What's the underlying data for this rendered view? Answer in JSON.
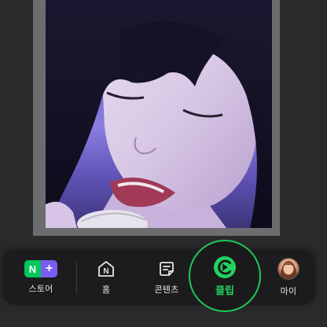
{
  "bottom_nav": {
    "items": [
      {
        "label": "스토어",
        "icon": "naver-plus-store-icon"
      },
      {
        "label": "홈",
        "icon": "naver-home-icon"
      },
      {
        "label": "콘텐츠",
        "icon": "contents-icon"
      },
      {
        "label": "클립",
        "icon": "clip-play-icon"
      },
      {
        "label": "마이",
        "icon": "profile-avatar"
      }
    ],
    "store_badge": {
      "left": "N",
      "right": "+"
    },
    "home_icon_letter": "N",
    "active_item": "클립"
  },
  "colors": {
    "accent_green": "#22d35f",
    "store_green": "#03c75a",
    "store_purple": "#7b5cf0",
    "nav_background": "#1c1c1e"
  }
}
